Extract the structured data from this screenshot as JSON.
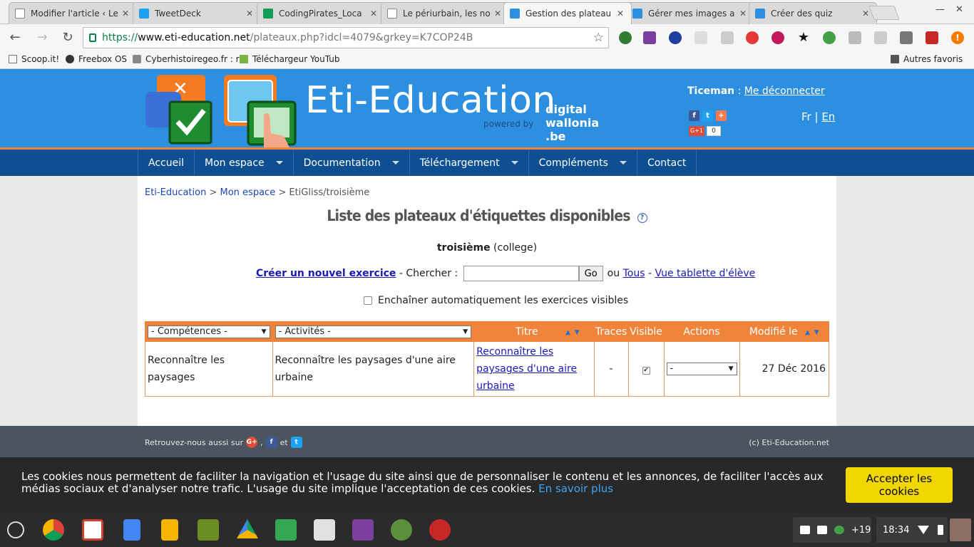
{
  "browser": {
    "tabs": [
      {
        "title": "Modifier l'article ‹ Le",
        "color": "#9e9e9e"
      },
      {
        "title": "TweetDeck",
        "color": "#1da1f2"
      },
      {
        "title": "CodingPirates_Loca",
        "color": "#0f9d58"
      },
      {
        "title": "Le périurbain, les no",
        "color": "#9e9e9e"
      },
      {
        "title": "Gestion des plateau",
        "color": "#2d8fdf"
      },
      {
        "title": "Gérer mes images a",
        "color": "#2d8fdf"
      },
      {
        "title": "Créer des quiz",
        "color": "#2d8fdf"
      }
    ],
    "active_tab": 4,
    "url": {
      "scheme": "https://",
      "host": "www.eti-education.net",
      "path": "/plateaux.php?idcl=4079&grkey=K7COP24B"
    },
    "bookmarks": [
      "Scoop.it!",
      "Freebox OS",
      "Cyberhistoiregeo.fr : r",
      "Téléchargeur YouTub"
    ],
    "other_bookmarks": "Autres favoris"
  },
  "header": {
    "brand": "Eti-Education",
    "powered": "powered by",
    "dw_line1": "digital",
    "dw_line2": "wallonia",
    "dw_line3": ".be",
    "username": "Ticeman",
    "separator": " : ",
    "logout": "Me déconnecter",
    "lang_fr": "Fr",
    "lang_sep": " | ",
    "lang_en": "En",
    "gplus_label": "G+1",
    "gplus_count": "0"
  },
  "menu": [
    {
      "label": "Accueil",
      "dropdown": false
    },
    {
      "label": "Mon espace",
      "dropdown": true
    },
    {
      "label": "Documentation",
      "dropdown": true
    },
    {
      "label": "Téléchargement",
      "dropdown": true
    },
    {
      "label": "Compléments",
      "dropdown": true
    },
    {
      "label": "Contact",
      "dropdown": false
    }
  ],
  "breadcrumb": {
    "home": "Eti-Education",
    "sep1": " > ",
    "space": "Mon espace",
    "sep2": " > ",
    "current": "EtiGliss/troisième"
  },
  "main": {
    "title": "Liste des plateaux d'étiquettes disponibles",
    "help": "?",
    "class_name": "troisième",
    "class_level": "(college)",
    "create": "Créer un nouvel exercice",
    "search_label": " - Chercher : ",
    "search_value": "",
    "go": "Go",
    "or": "ou",
    "all": "Tous",
    "dash": "-",
    "tablet": "Vue tablette d'élève",
    "chain_label": "Enchaîner automatiquement les exercices visibles"
  },
  "table": {
    "filter_competences": "- Compétences -",
    "filter_activites": "- Activités -",
    "headers": {
      "titre": "Titre",
      "traces": "Traces",
      "visible": "Visible",
      "actions": "Actions",
      "modified": "Modifié le"
    },
    "rows": [
      {
        "competence": "Reconnaître les paysages",
        "activite": "Reconnaître les paysages d'une aire urbaine",
        "titre": "Reconnaître les paysages d'une aire urbaine",
        "traces": "-",
        "visible": true,
        "action": "-",
        "modified": "27 Déc 2016"
      }
    ]
  },
  "footer": {
    "follow": "Retrouvez-nous aussi sur",
    "comma": ",",
    "and": "et",
    "copyright": "(c) Eti-Education.net"
  },
  "cookie": {
    "text": "Les cookies nous permettent de faciliter la navigation et l'usage du site ainsi que de personnaliser le contenu et les annonces, de faciliter l'accès aux médias sociaux et d'analyser notre trafic. L'usage du site implique l'acceptation de ces cookies.",
    "more": "En savoir plus",
    "accept": "Accepter les cookies"
  },
  "shelf": {
    "notif_count": "+19",
    "time": "18:34"
  },
  "colors": {
    "header_blue": "#2d8fdf",
    "nav_blue": "#0e4f92",
    "accent_orange": "#f0843a",
    "cookie_button": "#f1d600"
  }
}
